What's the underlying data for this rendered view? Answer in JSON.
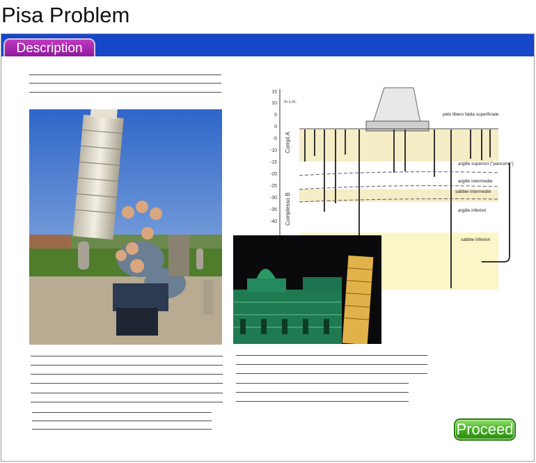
{
  "page": {
    "title": "Pisa Problem"
  },
  "tabs": [
    {
      "label": "Description"
    }
  ],
  "diagram": {
    "scale_unit": "m s.m.",
    "depth_ticks": [
      "15",
      "10",
      "5",
      "0",
      "-5",
      "-10",
      "-15",
      "-20",
      "-25",
      "-30",
      "-35",
      "-40"
    ],
    "complex_labels": [
      "Compl.A",
      "Complesso B"
    ],
    "layer_labels": [
      "pelo libero falda superficiale",
      "argille superiori (\"pancone\")",
      "argille intermedie",
      "sabbie intermedie",
      "argille inferiori",
      "sabbie inferiori"
    ]
  },
  "images": {
    "tower_photo": "tourists posing at the Leaning Tower of Pisa",
    "night_photo": "Pisa cathedral and tower at night"
  },
  "colors": {
    "header_bar": "#1846c8",
    "tab": "#a42aae",
    "proceed": "#3ea81e"
  },
  "actions": {
    "proceed_label": "Proceed"
  }
}
